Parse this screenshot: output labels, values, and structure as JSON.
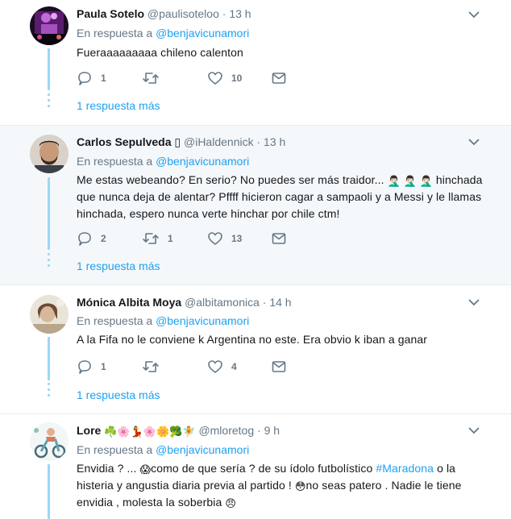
{
  "tweets": [
    {
      "name": "Paula Sotelo",
      "handle": "@paulisoteloo",
      "time": "13 h",
      "reply_prefix": "En respuesta a",
      "reply_mention": "@benjavicunamori",
      "text": "Fueraaaaaaaaa chileno calenton",
      "replies": "1",
      "retweets": "",
      "likes": "10",
      "more_replies": "1 respuesta más",
      "avatar_icon": "concert-avatar"
    },
    {
      "name": "Carlos Sepulveda",
      "name_badge": "▯",
      "handle": "@iHaldennick",
      "time": "13 h",
      "reply_prefix": "En respuesta a",
      "reply_mention": "@benjavicunamori",
      "text_line1": "Me estas webeando? En serio? No puedes ser más traidor...",
      "text_line1_emoji": "🤦🏻‍♂️ 🤦🏻‍♂️ 🤦🏻‍♂️",
      "text_line1_end": "hinchada",
      "text_line2": "que nunca deja de alentar? Pffff hicieron cagar a sampaoli y a Messi y le llamas",
      "text_line3": "hinchada, espero nunca verte hinchar por chile ctm!",
      "replies": "2",
      "retweets": "1",
      "likes": "13",
      "more_replies": "1 respuesta más",
      "avatar_icon": "man-avatar"
    },
    {
      "name": "Mónica Albita Moya",
      "handle": "@albitamonica",
      "time": "14 h",
      "reply_prefix": "En respuesta a",
      "reply_mention": "@benjavicunamori",
      "text": "A la Fifa no le conviene k Argentina no este. Era obvio k iban a ganar",
      "replies": "1",
      "retweets": "",
      "likes": "4",
      "more_replies": "1 respuesta más",
      "avatar_icon": "woman-avatar"
    },
    {
      "name": "Lore",
      "name_emoji": "☘️🌸💃🌸🌼🥦🧚",
      "handle": "@mloretog",
      "time": "9 h",
      "reply_prefix": "En respuesta a",
      "reply_mention": "@benjavicunamori",
      "text_a": "Envidia ? ...",
      "text_a_emoji": "😱",
      "text_b": "como de que sería  ?  de su ídolo  futbolístico",
      "hashtag": "#Maradona",
      "text_c": "o la",
      "text_line2": "histeria y angustia diaria previa al partido !",
      "text_line2_emoji": "😳",
      "text_line2_end": "no seas patero . Nadie le tiene",
      "text_line3": "envidia , molesta la soberbia",
      "text_line3_emoji": "😠",
      "avatar_icon": "scooter-avatar"
    }
  ],
  "separator_dot": "·",
  "colors": {
    "link": "#1da1f2",
    "muted": "#657786",
    "thread": "#9ad7f8",
    "highlight_bg": "#f5f8fa"
  }
}
